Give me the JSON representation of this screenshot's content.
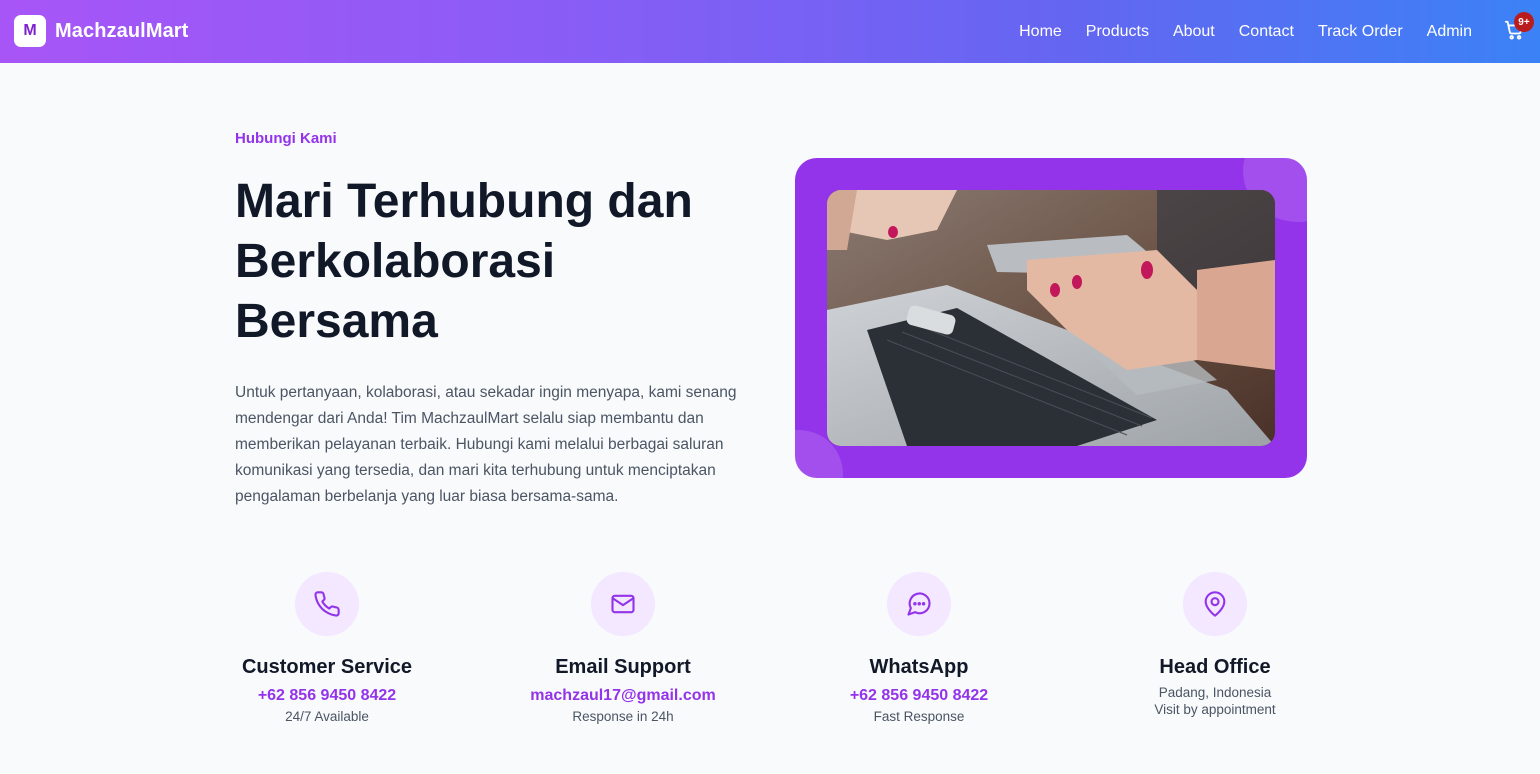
{
  "brand": {
    "logo_letter": "M",
    "name": "MachzaulMart"
  },
  "nav": {
    "items": [
      "Home",
      "Products",
      "About",
      "Contact",
      "Track Order",
      "Admin"
    ],
    "cart_badge": "9+"
  },
  "hero": {
    "eyebrow": "Hubungi Kami",
    "title_line1": "Mari Terhubung dan",
    "title_line2": "Berkolaborasi",
    "title_line3": "Bersama",
    "description": "Untuk pertanyaan, kolaborasi, atau sekadar ingin menyapa, kami senang mendengar dari Anda! Tim MachzaulMart selalu siap membantu dan memberikan pelayanan terbaik. Hubungi kami melalui berbagai saluran komunikasi yang tersedia, dan mari kita terhubung untuk menciptakan pengalaman berbelanja yang luar biasa bersama-sama."
  },
  "contacts": [
    {
      "icon": "phone-icon",
      "title": "Customer Service",
      "value": "+62 856 9450 8422",
      "sub": "24/7 Available"
    },
    {
      "icon": "mail-icon",
      "title": "Email Support",
      "value": "machzaul17@gmail.com",
      "sub": "Response in 24h"
    },
    {
      "icon": "chat-icon",
      "title": "WhatsApp",
      "value": "+62 856 9450 8422",
      "sub": "Fast Response"
    },
    {
      "icon": "location-pin-icon",
      "title": "Head Office",
      "sub": "Padang, Indonesia",
      "sub2": "Visit by appointment"
    }
  ],
  "colors": {
    "accent": "#9333ea",
    "nav_gradient_start": "#a855f7",
    "nav_gradient_end": "#3b82f6",
    "badge": "#b91c1c"
  }
}
